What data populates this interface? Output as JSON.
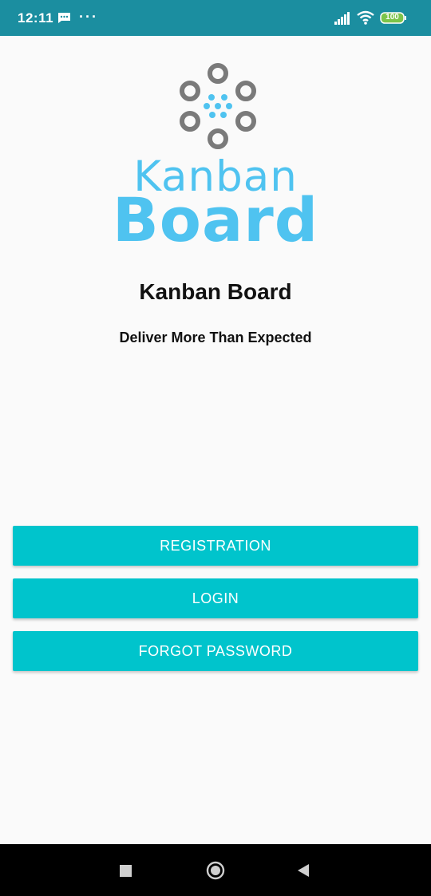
{
  "status_bar": {
    "time": "12:11",
    "overflow_dots": "···",
    "battery_level": "100",
    "icons": [
      "message-icon",
      "signal-icon",
      "wifi-icon",
      "battery-icon"
    ]
  },
  "logo": {
    "word_top": "Kanban",
    "word_bottom": "Board",
    "color": "#4fc3f0"
  },
  "app": {
    "title": "Kanban Board",
    "tagline": "Deliver More Than Expected"
  },
  "buttons": {
    "registration": "REGISTRATION",
    "login": "LOGIN",
    "forgot_password": "FORGOT PASSWORD",
    "color": "#00c4cc"
  },
  "nav_bar": {
    "icons": [
      "recent-apps-icon",
      "home-icon",
      "back-icon"
    ]
  }
}
